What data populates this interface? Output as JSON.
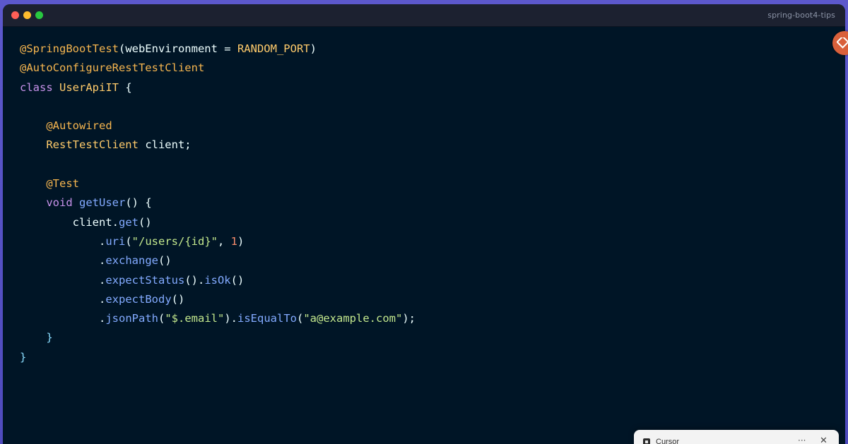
{
  "window": {
    "title": "spring-boot4-tips"
  },
  "editor": {
    "lines": [
      [
        {
          "t": "@SpringBootTest",
          "c": "anno"
        },
        {
          "t": "(webEnvironment = ",
          "c": "plain"
        },
        {
          "t": "RANDOM_PORT",
          "c": "type"
        },
        {
          "t": ")",
          "c": "plain"
        }
      ],
      [
        {
          "t": "@AutoConfigureRestTestClient",
          "c": "anno"
        }
      ],
      [
        {
          "t": "class ",
          "c": "kw"
        },
        {
          "t": "UserApiIT",
          "c": "type"
        },
        {
          "t": " {",
          "c": "plain"
        }
      ],
      [],
      [
        {
          "t": "    ",
          "c": "plain"
        },
        {
          "t": "@Autowired",
          "c": "anno"
        }
      ],
      [
        {
          "t": "    ",
          "c": "plain"
        },
        {
          "t": "RestTestClient",
          "c": "type"
        },
        {
          "t": " client;",
          "c": "plain"
        }
      ],
      [],
      [
        {
          "t": "    ",
          "c": "plain"
        },
        {
          "t": "@Test",
          "c": "anno"
        }
      ],
      [
        {
          "t": "    ",
          "c": "plain"
        },
        {
          "t": "void ",
          "c": "kw"
        },
        {
          "t": "getUser",
          "c": "method"
        },
        {
          "t": "() {",
          "c": "plain"
        }
      ],
      [
        {
          "t": "        client.",
          "c": "plain"
        },
        {
          "t": "get",
          "c": "method"
        },
        {
          "t": "()",
          "c": "plain"
        }
      ],
      [
        {
          "t": "            .",
          "c": "plain"
        },
        {
          "t": "uri",
          "c": "method"
        },
        {
          "t": "(",
          "c": "plain"
        },
        {
          "t": "\"/users/{id}\"",
          "c": "str"
        },
        {
          "t": ", ",
          "c": "plain"
        },
        {
          "t": "1",
          "c": "num"
        },
        {
          "t": ")",
          "c": "plain"
        }
      ],
      [
        {
          "t": "            .",
          "c": "plain"
        },
        {
          "t": "exchange",
          "c": "method"
        },
        {
          "t": "()",
          "c": "plain"
        }
      ],
      [
        {
          "t": "            .",
          "c": "plain"
        },
        {
          "t": "expectStatus",
          "c": "method"
        },
        {
          "t": "().",
          "c": "plain"
        },
        {
          "t": "isOk",
          "c": "method"
        },
        {
          "t": "()",
          "c": "plain"
        }
      ],
      [
        {
          "t": "            .",
          "c": "plain"
        },
        {
          "t": "expectBody",
          "c": "method"
        },
        {
          "t": "()",
          "c": "plain"
        }
      ],
      [
        {
          "t": "            .",
          "c": "plain"
        },
        {
          "t": "jsonPath",
          "c": "method"
        },
        {
          "t": "(",
          "c": "plain"
        },
        {
          "t": "\"$.email\"",
          "c": "str"
        },
        {
          "t": ").",
          "c": "plain"
        },
        {
          "t": "isEqualTo",
          "c": "method"
        },
        {
          "t": "(",
          "c": "plain"
        },
        {
          "t": "\"a@example.com\"",
          "c": "str"
        },
        {
          "t": ");",
          "c": "plain"
        }
      ],
      [
        {
          "t": "    }",
          "c": "punc"
        }
      ],
      [
        {
          "t": "}",
          "c": "punc"
        }
      ]
    ]
  },
  "notification": {
    "title": "Cursor",
    "more_label": "···",
    "close_label": "✕"
  },
  "colors": {
    "background": "#001526",
    "annotation": "#f5b54f",
    "keyword": "#c792ea",
    "type": "#ffcb6b",
    "method": "#82aaff",
    "string": "#c3e88d",
    "number": "#f78c6c"
  },
  "icons": {
    "side_badge": "git-diamond-icon",
    "notification": "cursor-app-icon"
  }
}
